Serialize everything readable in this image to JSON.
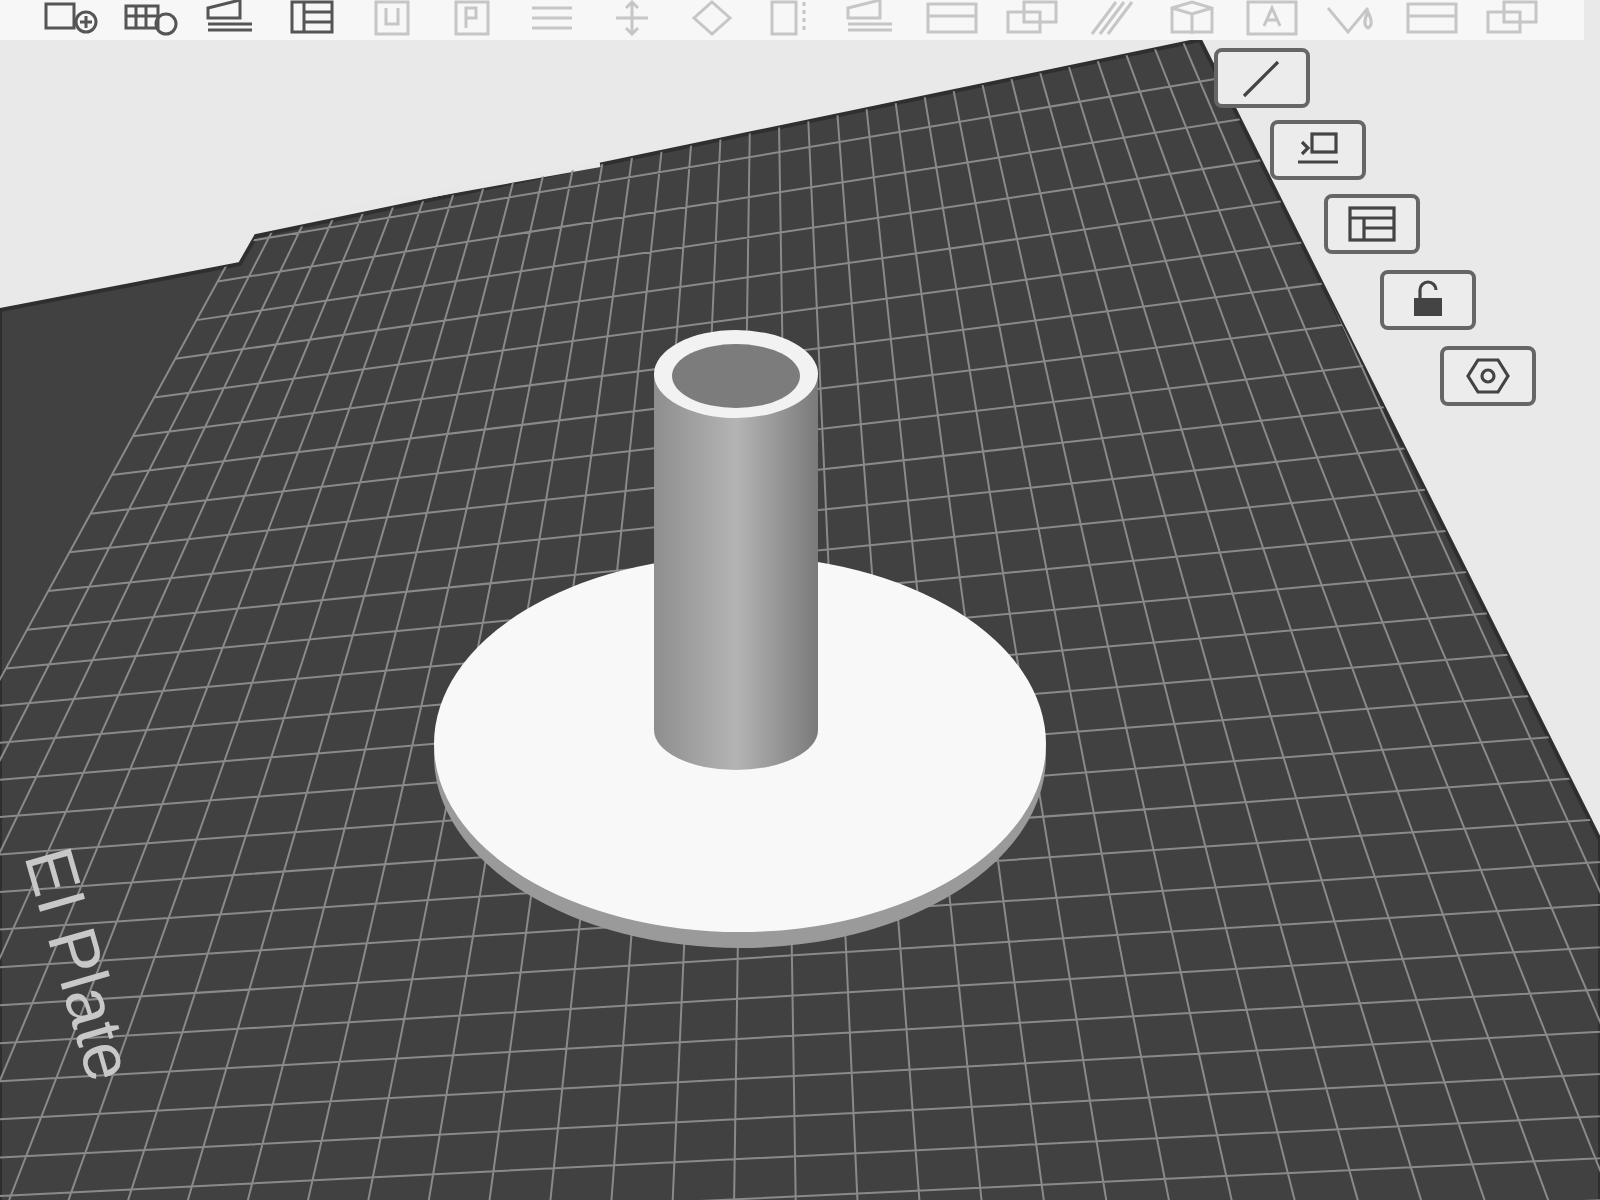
{
  "toolbar": {
    "items": [
      {
        "kind": "add-cube",
        "disabled": false
      },
      {
        "kind": "add-grid",
        "disabled": false
      },
      {
        "kind": "arrange",
        "disabled": false
      },
      {
        "kind": "layout",
        "disabled": false
      },
      {
        "kind": "plate-u",
        "disabled": true
      },
      {
        "kind": "plate-p",
        "disabled": true
      },
      {
        "kind": "lines",
        "disabled": true
      },
      {
        "kind": "move",
        "disabled": true
      },
      {
        "kind": "diamond",
        "disabled": true
      },
      {
        "kind": "split",
        "disabled": true
      },
      {
        "kind": "arrange",
        "disabled": true
      },
      {
        "kind": "rect",
        "disabled": true
      },
      {
        "kind": "stack",
        "disabled": true
      },
      {
        "kind": "stripes",
        "disabled": true
      },
      {
        "kind": "cube",
        "disabled": true
      },
      {
        "kind": "text",
        "disabled": true
      },
      {
        "kind": "drop",
        "disabled": true
      },
      {
        "kind": "rect",
        "disabled": true
      },
      {
        "kind": "stack",
        "disabled": true
      }
    ]
  },
  "side_buttons": [
    {
      "kind": "pencil"
    },
    {
      "kind": "auto"
    },
    {
      "kind": "layout"
    },
    {
      "kind": "lock"
    },
    {
      "kind": "nut"
    }
  ],
  "plate": {
    "label": "EI Plate"
  }
}
